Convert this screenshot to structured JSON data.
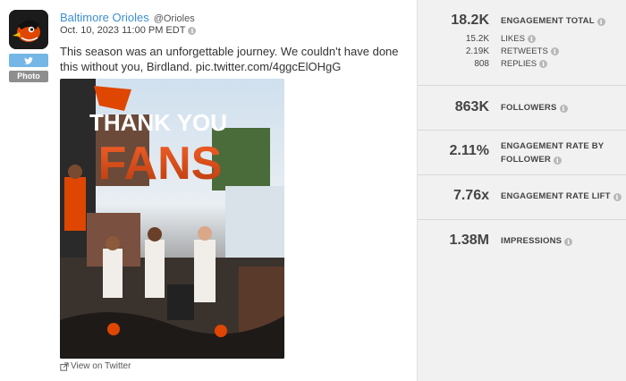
{
  "tweet": {
    "author_name": "Baltimore Orioles",
    "handle": "@Orioles",
    "date": "Oct. 10, 2023 11:00 PM EDT",
    "text": "This season was an unforgettable journey. We couldn't have done this without you, Birdland. pic.twitter.com/4ggcElOHgG",
    "type_badge": "Photo",
    "view_link": "View on Twitter",
    "image_text_line1": "THANK YOU",
    "image_text_line2": "FANS",
    "brand_color": "#3d8fd4",
    "twitter_color": "#74b6e6",
    "orioles_orange": "#df4601"
  },
  "metrics": {
    "engagement_total": {
      "value": "18.2K",
      "label": "ENGAGEMENT TOTAL"
    },
    "likes": {
      "value": "15.2K",
      "label": "LIKES"
    },
    "retweets": {
      "value": "2.19K",
      "label": "RETWEETS"
    },
    "replies": {
      "value": "808",
      "label": "REPLIES"
    },
    "followers": {
      "value": "863K",
      "label": "FOLLOWERS"
    },
    "engagement_rate": {
      "value": "2.11%",
      "label_line1": "ENGAGEMENT RATE BY",
      "label_line2": "FOLLOWER"
    },
    "engagement_lift": {
      "value": "7.76x",
      "label": "ENGAGEMENT RATE LIFT"
    },
    "impressions": {
      "value": "1.38M",
      "label": "IMPRESSIONS"
    }
  },
  "icons": {
    "avatar": "orioles-bird-logo",
    "twitter": "twitter-bird-icon",
    "info": "info-icon",
    "external": "external-link-icon"
  }
}
